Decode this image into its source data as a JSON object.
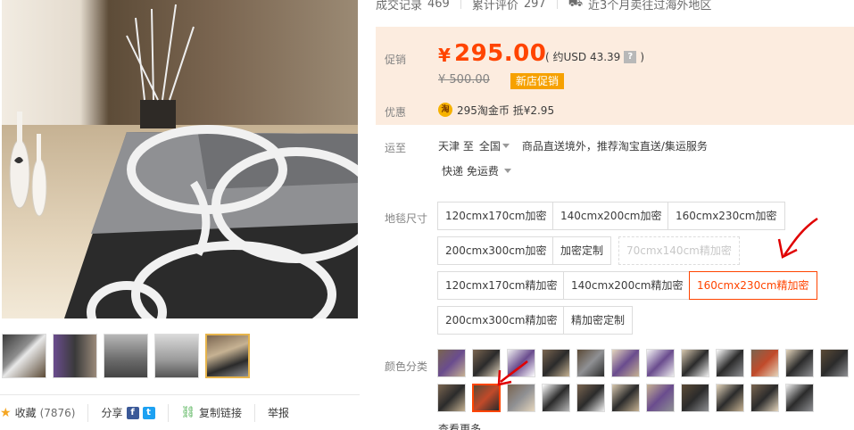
{
  "stats": {
    "deals_label": "成交记录",
    "deals_count": "469",
    "reviews_label": "累计评价",
    "reviews_count": "297",
    "overseas_text": "近3个月卖往过海外地区"
  },
  "promo": {
    "label": "促销",
    "currency": "¥",
    "price": "295.00",
    "usd_text": "( 约USD 43.39",
    "usd_close": ")",
    "help_icon": "question-icon",
    "original_price": "¥ 500.00",
    "tag": "新店促销",
    "discount_label": "优惠",
    "coin_icon": "taobao-coin-icon",
    "coin_glyph": "淘",
    "coin_text": "295淘金币 抵¥2.95"
  },
  "shipping": {
    "label": "运至",
    "from": "天津 至",
    "to": "全国",
    "service": "商品直送境外，推荐淘宝直送/集运服务",
    "method": "快递 免运费"
  },
  "size": {
    "label": "地毯尺寸",
    "options": [
      {
        "label": "120cmx170cm加密",
        "state": "normal"
      },
      {
        "label": "140cmx200cm加密",
        "state": "normal"
      },
      {
        "label": "160cmx230cm加密",
        "state": "normal"
      },
      {
        "label": "200cmx300cm加密",
        "state": "normal"
      },
      {
        "label": "加密定制",
        "state": "normal"
      },
      {
        "label": "70cmx140cm精加密",
        "state": "disabled"
      },
      {
        "label": "120cmx170cm精加密",
        "state": "normal"
      },
      {
        "label": "140cmx200cm精加密",
        "state": "normal"
      },
      {
        "label": "160cmx230cm精加密",
        "state": "selected"
      },
      {
        "label": "200cmx300cm精加密",
        "state": "normal"
      },
      {
        "label": "精加密定制",
        "state": "normal"
      }
    ]
  },
  "color": {
    "label": "颜色分类",
    "selected_index": 13
  },
  "bottom_bar": {
    "favorite_label": "收藏",
    "favorite_count": "(7876)",
    "share_label": "分享",
    "copy_link_label": "复制链接",
    "report_label": "举报"
  },
  "colors": {
    "price": "#ff4400",
    "promo_bg": "#fcecdf",
    "tag_bg": "#f6a100",
    "annotation_arrow": "#e00000"
  },
  "more_label": "查看更多"
}
